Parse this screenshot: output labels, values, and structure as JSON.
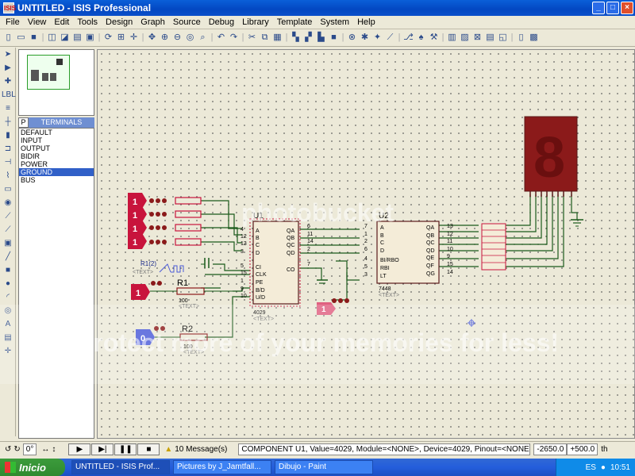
{
  "window": {
    "title": "UNTITLED - ISIS Professional",
    "icon_label": "ISIS",
    "buttons": [
      "minimize",
      "maximize",
      "close"
    ]
  },
  "menu": [
    "File",
    "View",
    "Edit",
    "Tools",
    "Design",
    "Graph",
    "Source",
    "Debug",
    "Library",
    "Template",
    "System",
    "Help"
  ],
  "selector": {
    "mode_button": "P",
    "title": "TERMINALS",
    "items": [
      "DEFAULT",
      "INPUT",
      "OUTPUT",
      "BIDIR",
      "POWER",
      "GROUND",
      "BUS"
    ],
    "selected": "GROUND"
  },
  "schematic": {
    "u1": {
      "ref": "U1",
      "part": "4029",
      "text_label": "<TEXT>",
      "pins_left": [
        "A",
        "B",
        "C",
        "D",
        "CI",
        "CLK",
        "PE",
        "B/D",
        "U/D"
      ],
      "pins_left_nums": [
        "4",
        "12",
        "13",
        "3",
        "5",
        "15",
        "1",
        "9",
        "10"
      ],
      "pins_right": [
        "QA",
        "QB",
        "QC",
        "QD",
        "CO"
      ],
      "pins_right_nums": [
        "6",
        "11",
        "14",
        "2",
        "7"
      ]
    },
    "u2": {
      "ref": "U2",
      "part": "7448",
      "text_label": "<TEXT>",
      "pins_left": [
        "A",
        "B",
        "C",
        "D",
        "BI/RBO",
        "RBI",
        "LT"
      ],
      "pins_left_nums": [
        "7",
        "1",
        "2",
        "6",
        "4",
        "5",
        "3"
      ],
      "pins_right": [
        "QA",
        "QB",
        "QC",
        "QD",
        "QE",
        "QF",
        "QG"
      ],
      "pins_right_nums": [
        "13",
        "12",
        "11",
        "10",
        "9",
        "15",
        "14"
      ]
    },
    "r1": {
      "ref": "R1",
      "value": "100",
      "text_label": "<TEXT>"
    },
    "r2": {
      "ref": "R2",
      "value": "100",
      "text_label": "<TEXT>"
    },
    "clock": {
      "ref": "R1(2)",
      "text_label": "<TEXT>"
    },
    "logic_states": [
      "1",
      "1",
      "1",
      "1"
    ],
    "logic_r1": "1",
    "logic_r2": "0",
    "logic_probe": "1",
    "display_digit": "8"
  },
  "watermark": {
    "line1": "photobucket",
    "line2": "Protect more of your memories for less!"
  },
  "status": {
    "rotation": "0°",
    "messages": "10 Message(s)",
    "component": "COMPONENT U1, Value=4029, Module=<NONE>, Device=4029, Pinout=<NONE>",
    "coord_x": "-2650.0",
    "coord_y": "+500.0",
    "units": "th"
  },
  "taskbar": {
    "start": "Inicio",
    "tasks": [
      "UNTITLED - ISIS Prof...",
      "Pictures by J_Jamtfall...",
      "Dibujo - Paint"
    ],
    "language": "ES",
    "clock": "10:51"
  },
  "colors": {
    "accent": "#0a5fd8",
    "wire": "#1a5a1a",
    "component_outline": "#5a1a1a",
    "segment_display": "#8b1a1a",
    "logic_red": "#c8143c",
    "logic_blue": "#4a5ad8"
  }
}
